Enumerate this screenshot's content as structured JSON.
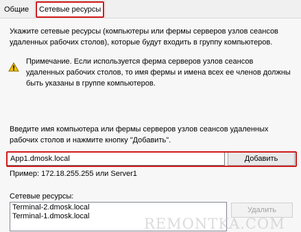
{
  "tabs": [
    {
      "label": "Общие"
    },
    {
      "label": "Сетевые ресурсы"
    }
  ],
  "description": "Укажите сетевые ресурсы (компьютеры или фермы серверов узлов сеансов удаленных рабочих столов), которые будут входить в группу компьютеров.",
  "note": "Примечание. Если используется ферма серверов узлов сеансов удаленных рабочих столов, то имя фермы и имена всех ее членов должны быть указаны в группе компьютеров.",
  "enter_prompt": "Введите имя компьютера или фермы серверов узлов сеансов удаленных рабочих столов и нажмите кнопку \"Добавить\".",
  "input": {
    "value": "App1.dmosk.local"
  },
  "add_button": "Добавить",
  "example": "Пример: 172.18.255.255 или Server1",
  "resources_label": "Сетевые ресурсы:",
  "resources": [
    "Terminal-2.dmosk.local",
    "Terminal-1.dmosk.local"
  ],
  "remove_button": "Удалить",
  "watermark": "REMONTKA.COM",
  "colors": {
    "highlight": "#d11a1a",
    "warning": "#f5c400"
  },
  "icons": {
    "note": "warning-icon"
  }
}
